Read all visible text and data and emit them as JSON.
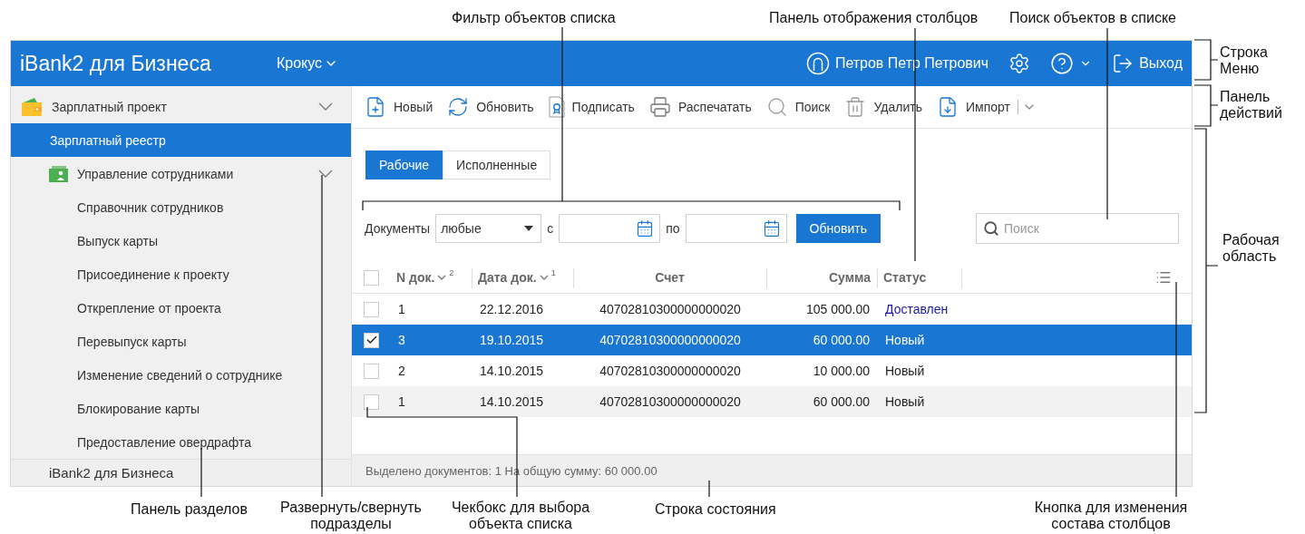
{
  "callouts": {
    "top": [
      "Фильтр объектов списка",
      "Панель отображения столбцов",
      "Поиск объектов в списке"
    ],
    "right": [
      "Строка Меню",
      "Панель действий",
      "Рабочая область"
    ],
    "bottom": [
      "Панель разделов",
      "Развернуть/свернуть подразделы",
      "Чекбокс для выбора объекта списка",
      "Строка состояния",
      "Кнопка для изменения состава столбцов"
    ]
  },
  "header": {
    "title": "iBank2 для Бизнеса",
    "organization": "Крокус",
    "user": "Петров Петр Петрович",
    "exit": "Выход"
  },
  "sidebar": {
    "items": [
      {
        "label": "Зарплатный проект",
        "selected": false,
        "expanded": true,
        "children": [
          {
            "label": "Зарплатный реестр",
            "selected": true
          },
          {
            "label": "Управление сотрудниками",
            "selected": false,
            "expanded": true,
            "children": [
              {
                "label": "Справочник сотрудников",
                "selected": false
              },
              {
                "label": "Выпуск карты",
                "selected": false
              },
              {
                "label": "Присоединение к проекту",
                "selected": false
              },
              {
                "label": "Открепление от проекта",
                "selected": false
              },
              {
                "label": "Перевыпуск карты",
                "selected": false
              },
              {
                "label": "Изменение сведений о сотруднике",
                "selected": false
              },
              {
                "label": "Блокирование карты",
                "selected": false
              },
              {
                "label": "Предоставление овердрафта",
                "selected": false
              }
            ]
          }
        ]
      }
    ],
    "footer": "iBank2 для Бизнеса"
  },
  "toolbar": [
    {
      "label": "Новый",
      "kind": "new"
    },
    {
      "label": "Обновить",
      "kind": "refresh"
    },
    {
      "label": "Подписать",
      "kind": "sign"
    },
    {
      "label": "Распечатать",
      "kind": "print"
    },
    {
      "label": "Поиск",
      "kind": "search"
    },
    {
      "label": "Удалить",
      "kind": "delete"
    },
    {
      "label": "Импорт",
      "kind": "import"
    }
  ],
  "tabs": [
    {
      "label": "Рабочие",
      "selected": true
    },
    {
      "label": "Исполненные",
      "selected": false
    }
  ],
  "filter": {
    "label": "Документы",
    "type_value": "любые",
    "from_label": "с",
    "to_label": "по",
    "button": "Обновить"
  },
  "search": {
    "placeholder": "Поиск"
  },
  "table": {
    "all_checked": false,
    "columns": [
      {
        "label": "N док.",
        "sort_rank": "2"
      },
      {
        "label": "Дата док.",
        "sort_rank": "1"
      },
      {
        "label": "Счет"
      },
      {
        "label": "Сумма"
      },
      {
        "label": "Статус"
      }
    ],
    "rows": [
      {
        "checked": false,
        "selected": false,
        "kind": "delivered",
        "cells": [
          "1",
          "22.12.2016",
          "40702810300000000020",
          "105 000.00",
          "Доставлен"
        ]
      },
      {
        "checked": true,
        "selected": true,
        "kind": "new",
        "cells": [
          "3",
          "19.10.2015",
          "40702810300000000020",
          "60 000.00",
          "Новый"
        ]
      },
      {
        "checked": false,
        "selected": false,
        "kind": "new",
        "cells": [
          "2",
          "14.10.2015",
          "40702810300000000020",
          "10 000.00",
          "Новый"
        ]
      },
      {
        "checked": false,
        "selected": false,
        "kind": "new",
        "cells": [
          "1",
          "14.10.2015",
          "40702810300000000020",
          "60 000.00",
          "Новый"
        ]
      }
    ]
  },
  "status_bar": "Выделено документов: 1 На общую сумму: 60 000.00"
}
